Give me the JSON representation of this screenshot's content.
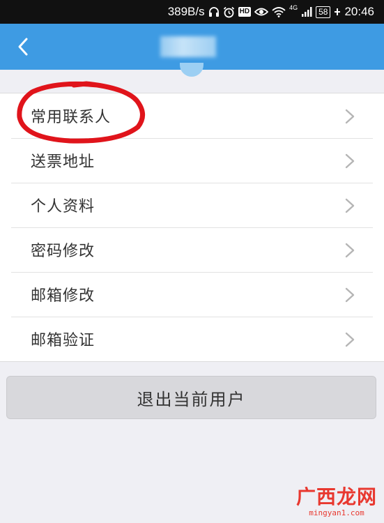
{
  "status_bar": {
    "speed": "389B/s",
    "hd": "HD",
    "network": "4G",
    "battery": "58",
    "time": "20:46"
  },
  "nav": {
    "back_icon": "chevron-left-icon"
  },
  "menu": {
    "items": [
      {
        "label": "常用联系人"
      },
      {
        "label": "送票地址"
      },
      {
        "label": "个人资料"
      },
      {
        "label": "密码修改"
      },
      {
        "label": "邮箱修改"
      },
      {
        "label": "邮箱验证"
      }
    ]
  },
  "logout_label": "退出当前用户",
  "watermark": {
    "title": "广西龙网",
    "sub": "mingyan1.com"
  },
  "colors": {
    "nav_blue": "#3e9be3",
    "annotation_red": "#e0141b",
    "watermark_red": "#e8382f"
  }
}
